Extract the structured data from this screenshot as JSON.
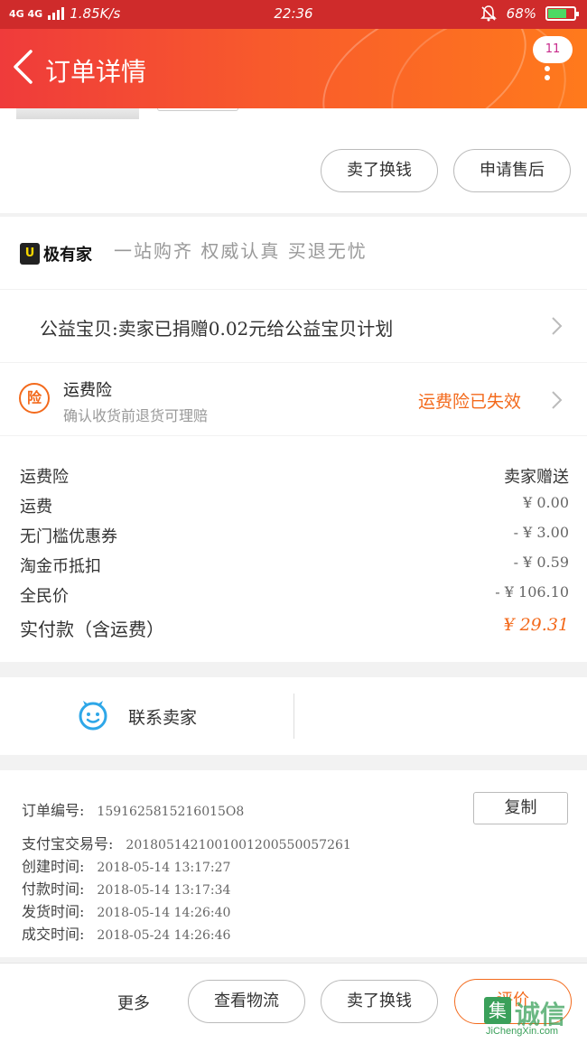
{
  "status_bar": {
    "signal": "4G 4G",
    "speed": "1.85K/s",
    "time": "22:36",
    "battery": "68%",
    "battery_level": 0.68
  },
  "header": {
    "title": "订单详情",
    "message_count": "11"
  },
  "actions": {
    "sell_button": "卖了换钱",
    "after_sales_button": "申请售后"
  },
  "jiyoujia": {
    "brand": "极有家",
    "logo_char": "U",
    "slogan": "一站购齐 权威认真 买退无忧"
  },
  "charity": {
    "text": "公益宝贝:卖家已捐赠0.02元给公益宝贝计划"
  },
  "insurance": {
    "icon_char": "险",
    "title": "运费险",
    "subtitle": "确认收货前退货可理赔",
    "status": "运费险已失效"
  },
  "fees": [
    {
      "label": "运费险",
      "value": "卖家赠送"
    },
    {
      "label": "运费",
      "value": "¥ 0.00"
    },
    {
      "label": "无门槛优惠券",
      "value": "- ¥ 3.00"
    },
    {
      "label": "淘金币抵扣",
      "value": "- ¥ 0.59"
    },
    {
      "label": "全民价",
      "value": "- ¥ 106.10"
    }
  ],
  "total": {
    "label": "实付款（含运费）",
    "value": "¥ 29.31"
  },
  "contact": {
    "label": "联系卖家"
  },
  "order_info": {
    "order_no_label": "订单编号:",
    "order_no": "1591625815216015O8",
    "copy_button": "复制",
    "alipay_label": "支付宝交易号:",
    "alipay_no": "2018051421001001200550057261",
    "created_label": "创建时间:",
    "created": "2018-05-14 13:17:27",
    "paid_label": "付款时间:",
    "paid": "2018-05-14 13:17:34",
    "shipped_label": "发货时间:",
    "shipped": "2018-05-14 14:26:40",
    "completed_label": "成交时间:",
    "completed": "2018-05-24 14:26:46"
  },
  "bottom_bar": {
    "more": "更多",
    "logistics_button": "查看物流",
    "sell_button": "卖了换钱",
    "evaluate_button": "评价"
  },
  "watermark": {
    "mark": "集",
    "text": "诚信",
    "url": "JiChengXin.com"
  }
}
